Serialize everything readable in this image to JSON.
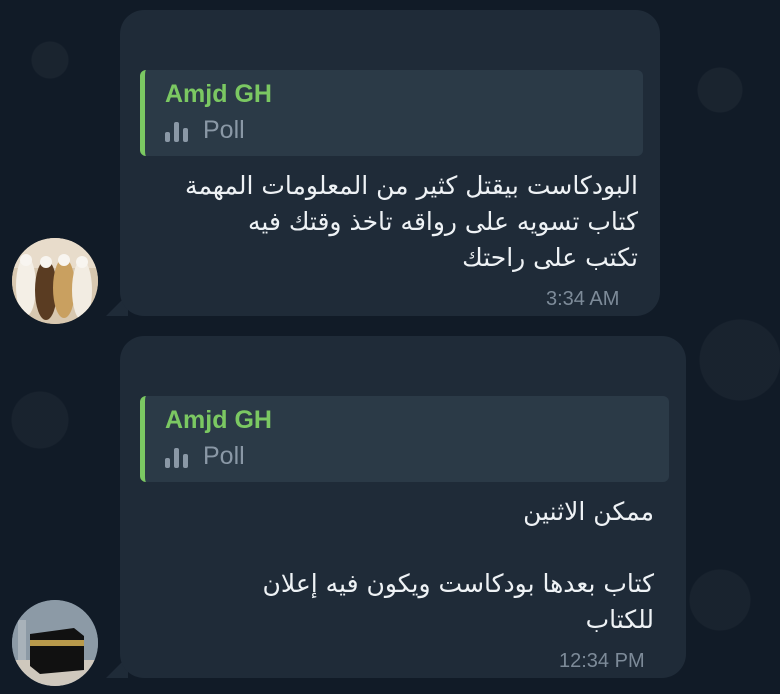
{
  "messages": [
    {
      "quote_author": "Amjd GH",
      "quote_type": "Poll",
      "text": "البودكاست بيقتل كثير من المعلومات المهمة\nكتاب تسويه على رواقه تاخذ وقتك فيه\nتكتب على راحتك",
      "time": "3:34 AM",
      "avatar": "avatar-group-photo"
    },
    {
      "quote_author": "Amjd GH",
      "quote_type": "Poll",
      "text": "ممكن الاثنين\n\nكتاب بعدها بودكاست ويكون فيه إعلان\nللكتاب",
      "time": "12:34 PM",
      "avatar": "avatar-kaaba"
    }
  ],
  "colors": {
    "background": "#111b27",
    "bubble": "#1f2b38",
    "quote_bg": "#2b3a47",
    "accent_green": "#7bc862",
    "text": "#eef2f5",
    "meta": "#7d8b99"
  },
  "icons": {
    "poll": "poll-bars-icon"
  }
}
